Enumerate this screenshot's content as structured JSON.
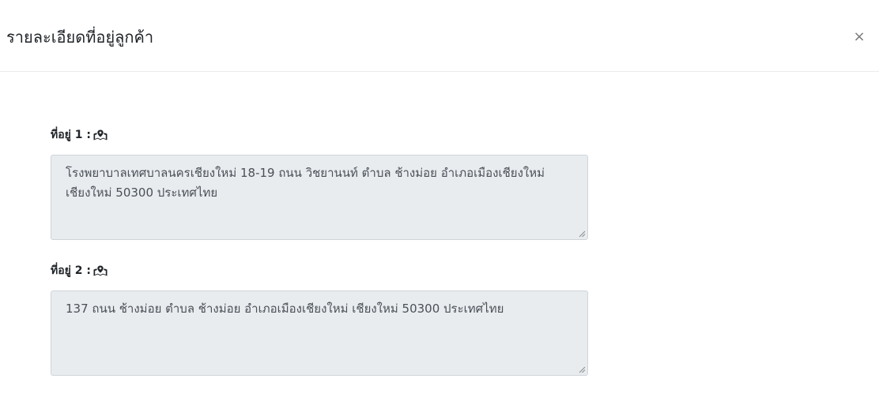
{
  "modal": {
    "title": "รายละเอียดที่อยู่ลูกค้า",
    "close_symbol": "×"
  },
  "addresses": [
    {
      "label": "ที่อยู่ 1 :",
      "icon": "map-marked-icon",
      "value": "โรงพยาบาลเทศบาลนครเชียงใหม่ 18-19 ถนน วิชยานนท์ ตำบล ช้างม่อย อำเภอเมืองเชียงใหม่ เชียงใหม่ 50300 ประเทศไทย"
    },
    {
      "label": "ที่อยู่ 2 :",
      "icon": "map-marked-icon",
      "value": "137 ถนน ช้างม่อย ตำบล ช้างม่อย อำเภอเมืองเชียงใหม่ เชียงใหม่ 50300 ประเทศไทย"
    }
  ],
  "colors": {
    "readonly_bg": "#e9ecef",
    "border": "#ced4da",
    "text": "#212529"
  }
}
